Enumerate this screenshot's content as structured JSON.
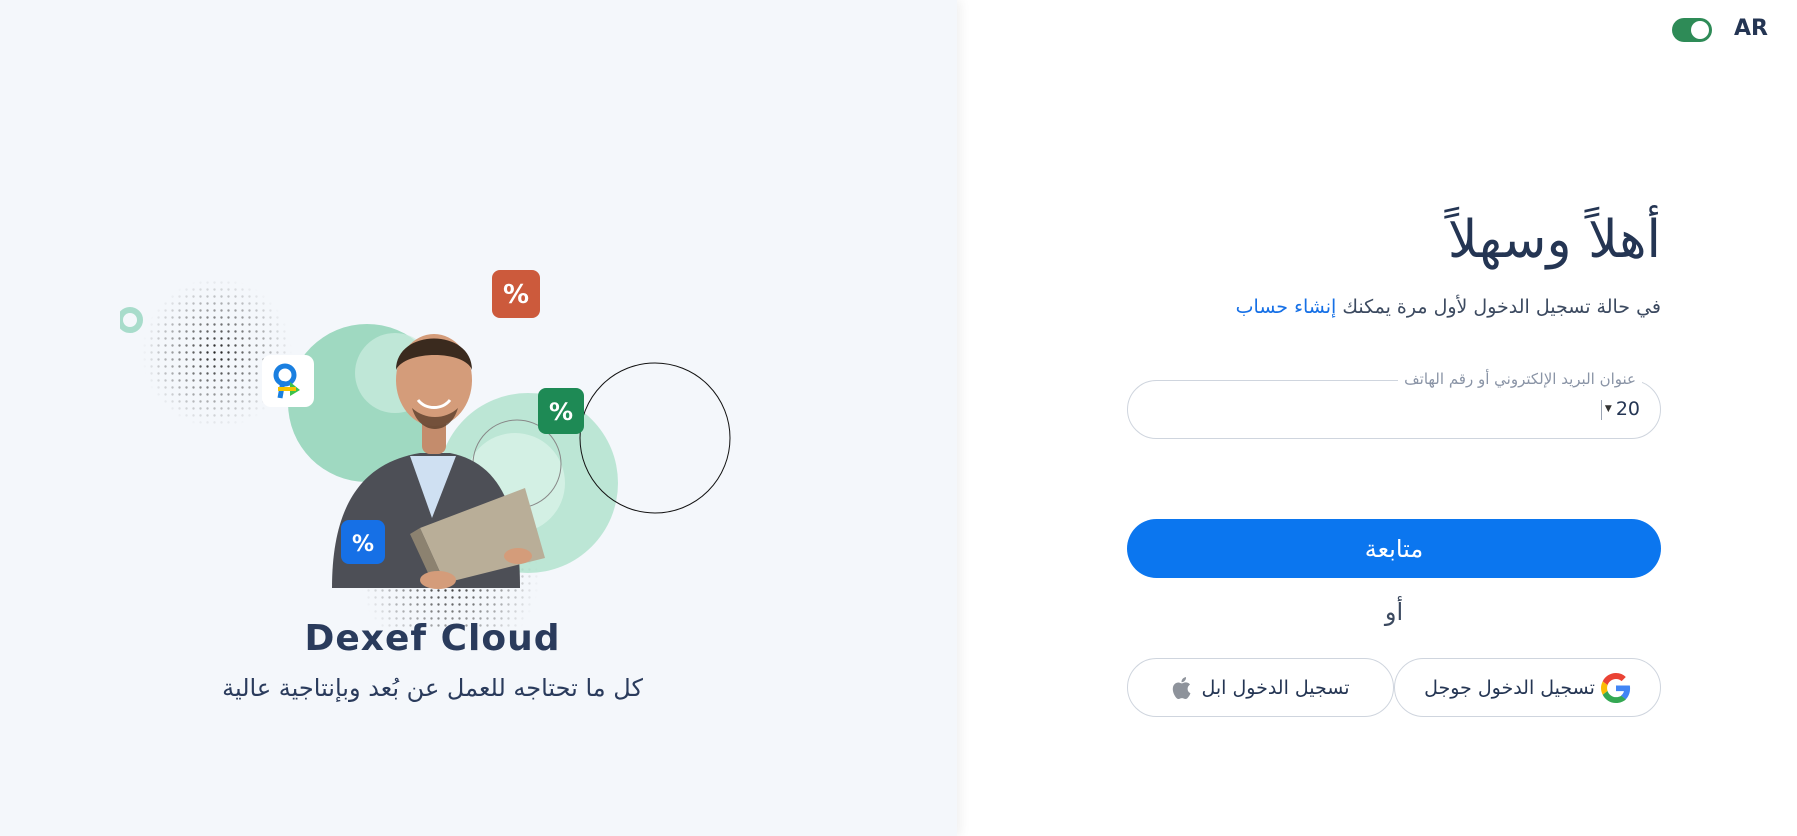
{
  "brand": {
    "name": "Dexef Cloud",
    "tagline": "كل ما تحتاجه للعمل عن بُعد وبإنتاجية عالية"
  },
  "language": {
    "label": "AR",
    "toggle_on": true
  },
  "form": {
    "title": "أهلاً وسهلاً",
    "subtitle_text": "في حالة تسجيل الدخول لأول مرة يمكنك",
    "create_account_link": "إنشاء حساب",
    "identifier_label": "عنوان البريد الإلكتروني أو رقم الهاتف",
    "country_code": "20",
    "identifier_value": "",
    "continue_label": "متابعة",
    "or_label": "أو",
    "google_label": "تسجيل الدخول جوجل",
    "apple_label": "تسجيل الدخول ابل"
  },
  "icons": {
    "google": "google-icon",
    "apple": "apple-icon",
    "toggle": "language-toggle",
    "caret": "chevron-down-icon"
  },
  "colors": {
    "primary": "#0b76ef",
    "link": "#1670e6",
    "toggle": "#2e8b57",
    "text": "#243553",
    "left_bg": "#f4f7fb"
  }
}
